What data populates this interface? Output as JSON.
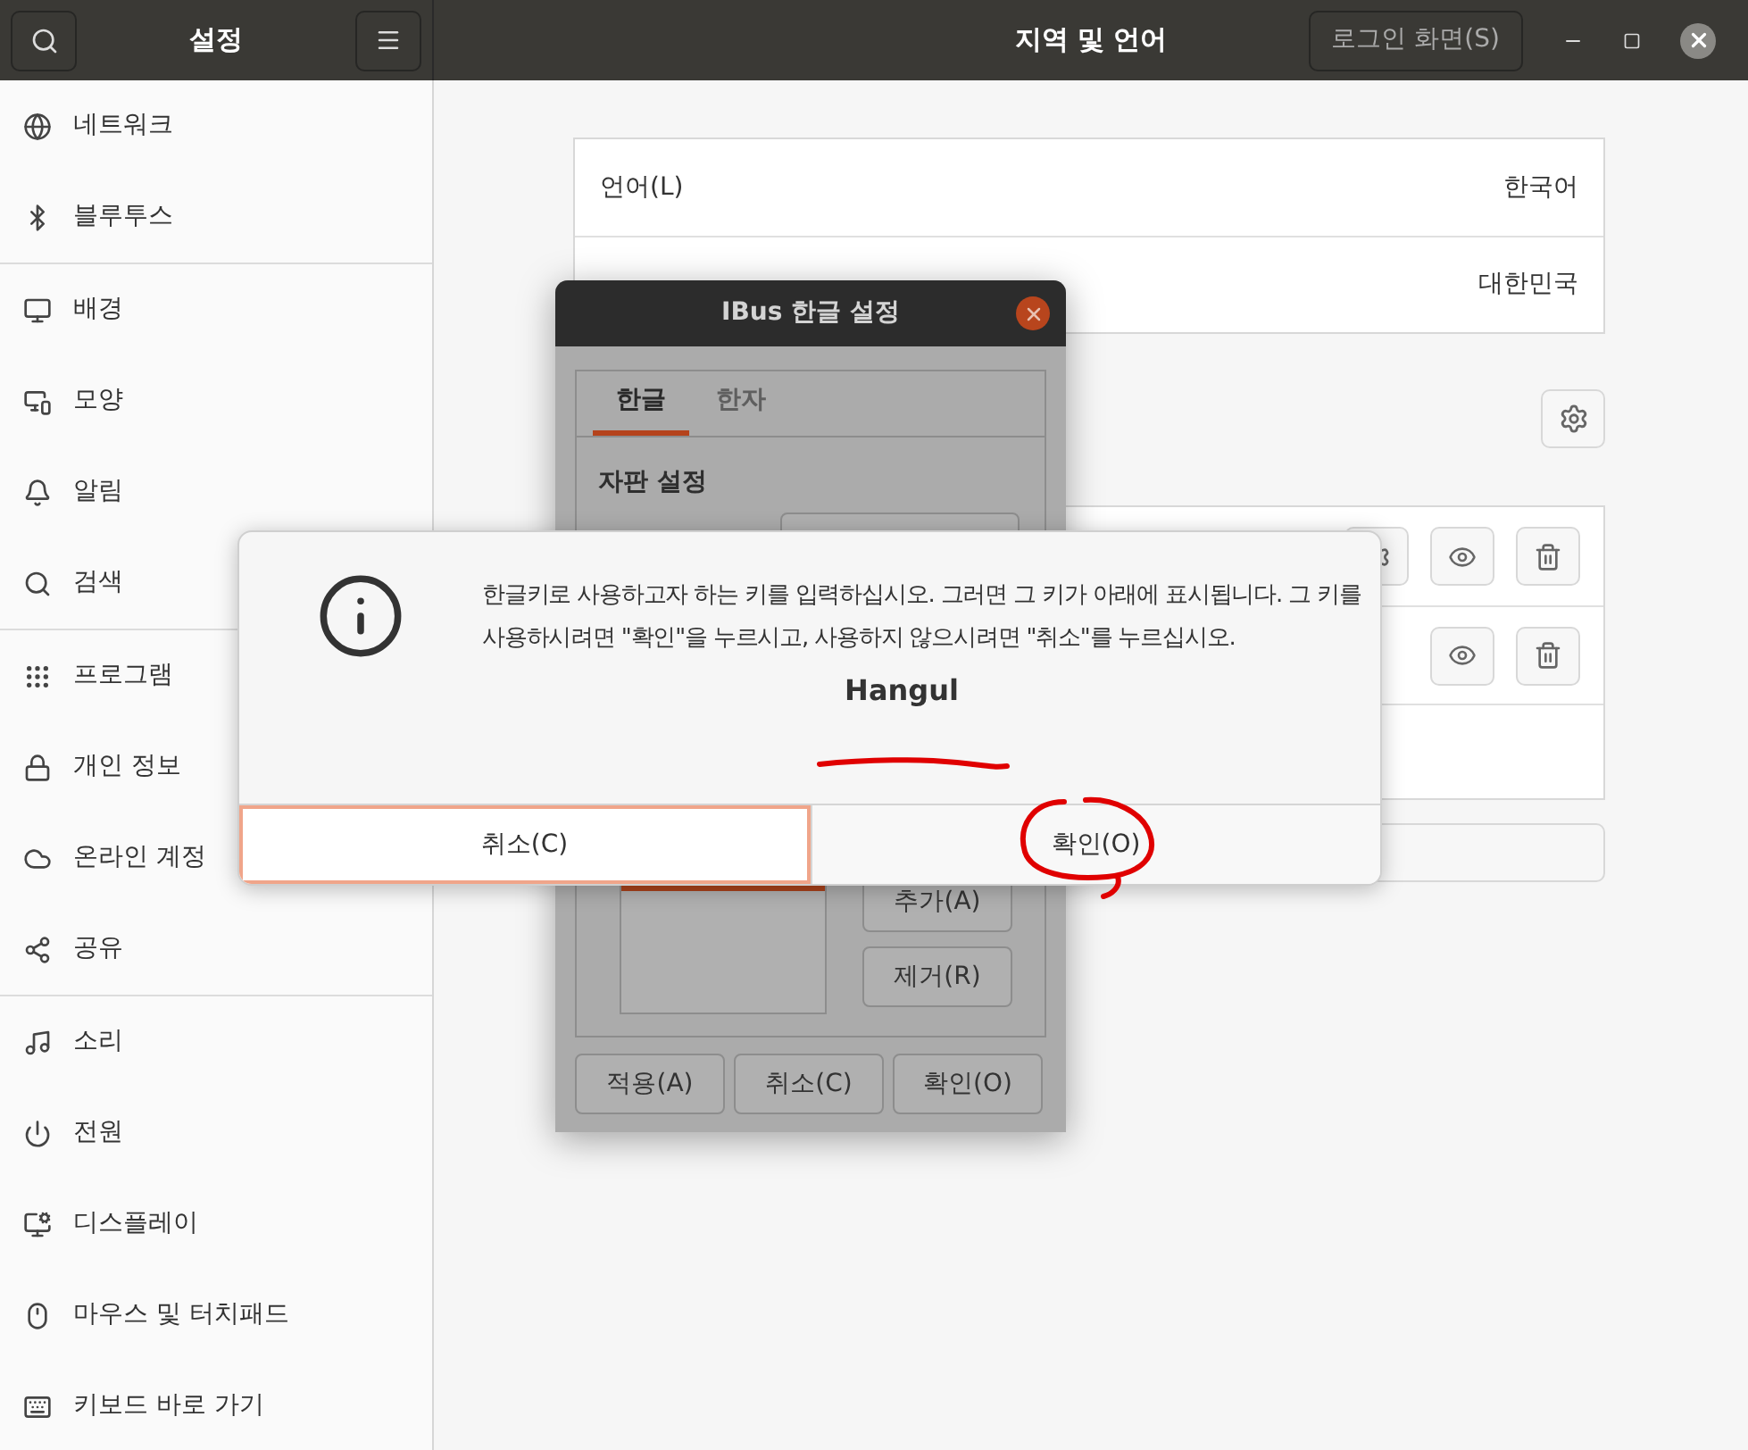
{
  "header": {
    "sidebar_title": "설정",
    "title": "지역 및 언어",
    "login_button": "로그인 화면(S)"
  },
  "sidebar": {
    "groups": [
      [
        "네트워크",
        "블루투스"
      ],
      [
        "배경",
        "모양",
        "알림",
        "검색"
      ],
      [
        "프로그램",
        "개인 정보",
        "온라인 계정",
        "공유"
      ],
      [
        "소리",
        "전원",
        "디스플레이",
        "마우스 및 터치패드",
        "키보드 바로 가기"
      ]
    ]
  },
  "language_card": {
    "rows": [
      {
        "label": "언어(L)",
        "value": "한국어"
      },
      {
        "value": "대한민국"
      }
    ]
  },
  "ibus_dialog": {
    "title": "IBus 한글 설정",
    "tabs": [
      {
        "label": "한글",
        "selected": true
      },
      {
        "label": "한자",
        "selected": false
      }
    ],
    "section": "자판 설정",
    "side_buttons": [
      "추가(A)",
      "제거(R)"
    ],
    "buttons": [
      "적용(A)",
      "취소(C)",
      "확인(O)"
    ]
  },
  "message_dialog": {
    "message": "한글키로 사용하고자 하는 키를 입력하십시오. 그러면 그 키가 아래에 표시됩니다. 그 키를 사용하시려면 \"확인\"을 누르시고, 사용하지 않으시려면 \"취소\"를 누르십시오.",
    "key": "Hangul",
    "buttons": [
      {
        "label": "취소(C)",
        "focused": true
      },
      {
        "label": "확인(O)",
        "focused": false
      }
    ]
  }
}
